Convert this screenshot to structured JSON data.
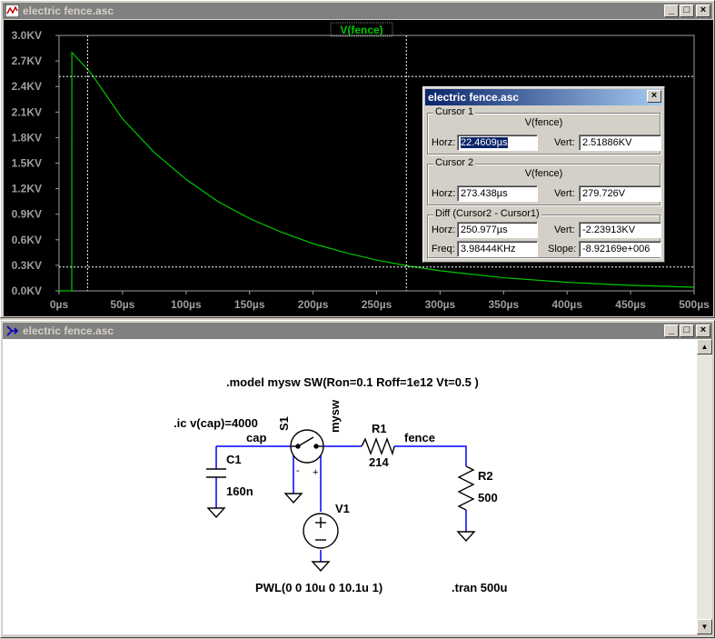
{
  "plot_window": {
    "title": "electric fence.asc",
    "trace_label": "V(fence)",
    "buttons": {
      "minimize": "_",
      "restore": "□",
      "close": "×"
    }
  },
  "chart_data": {
    "type": "line",
    "series": [
      {
        "name": "V(fence)",
        "color": "#00c800",
        "x": [
          0,
          10,
          10.1,
          25,
          50,
          75,
          100,
          125,
          150,
          175,
          200,
          225,
          250,
          275,
          300,
          350,
          400,
          450,
          500
        ],
        "y": [
          0,
          0,
          2800,
          2560,
          2020,
          1625,
          1310,
          1050,
          850,
          690,
          555,
          450,
          362,
          292,
          236,
          154,
          100,
          65,
          42
        ]
      }
    ],
    "xlim": [
      0,
      500
    ],
    "ylim": [
      0,
      3000
    ],
    "x_ticks": [
      0,
      50,
      100,
      150,
      200,
      250,
      300,
      350,
      400,
      450,
      500
    ],
    "x_tick_labels": [
      "0µs",
      "50µs",
      "100µs",
      "150µs",
      "200µs",
      "250µs",
      "300µs",
      "350µs",
      "400µs",
      "450µs",
      "500µs"
    ],
    "y_ticks": [
      0,
      300,
      600,
      900,
      1200,
      1500,
      1800,
      2100,
      2400,
      2700,
      3000
    ],
    "y_tick_labels": [
      "0.0KV",
      "0.3KV",
      "0.6KV",
      "0.9KV",
      "1.2KV",
      "1.5KV",
      "1.8KV",
      "2.1KV",
      "2.4KV",
      "2.7KV",
      "3.0KV"
    ],
    "grid": true,
    "cursors": [
      {
        "x": 22.4609,
        "y": 2518.86
      },
      {
        "x": 273.438,
        "y": 279.726
      }
    ]
  },
  "cursor_dialog": {
    "title": "electric fence.asc",
    "close": "×",
    "cursor1": {
      "label": "Cursor 1",
      "signal": "V(fence)",
      "horz_label": "Horz:",
      "horz": "22.4609µs",
      "vert_label": "Vert:",
      "vert": "2.51886KV"
    },
    "cursor2": {
      "label": "Cursor 2",
      "signal": "V(fence)",
      "horz_label": "Horz:",
      "horz": "273.438µs",
      "vert_label": "Vert:",
      "vert": "279.726V"
    },
    "diff": {
      "label": "Diff (Cursor2 - Cursor1)",
      "horz_label": "Horz:",
      "horz": "250.977µs",
      "vert_label": "Vert:",
      "vert": "-2.23913KV",
      "freq_label": "Freq:",
      "freq": "3.98444KHz",
      "slope_label": "Slope:",
      "slope": "-8.92169e+006"
    }
  },
  "schematic_window": {
    "title": "electric fence.asc",
    "buttons": {
      "minimize": "_",
      "restore": "□",
      "close": "×"
    },
    "scroll": {
      "up": "▲",
      "down": "▼"
    },
    "directives": {
      "model": ".model mysw SW(Ron=0.1 Roff=1e12 Vt=0.5 )",
      "ic": ".ic v(cap)=4000",
      "tran": ".tran 500u",
      "pwl": "PWL(0 0 10u 0 10.1u 1)"
    },
    "components": {
      "s1_name": "S1",
      "s1_model": "mysw",
      "r1_name": "R1",
      "r1_value": "214",
      "r2_name": "R2",
      "r2_value": "500",
      "c1_name": "C1",
      "c1_value": "160n",
      "v1_name": "V1"
    },
    "nets": {
      "cap": "cap",
      "fence": "fence"
    },
    "pins": {
      "minus": "-",
      "plus": "+",
      "src_plus": "+",
      "src_minus": "-"
    }
  },
  "colors": {
    "trace": "#00c800",
    "axis": "#9e9e9e",
    "grid": "#ffffff",
    "wire": "#0000ff",
    "title_inactive": "#808080"
  }
}
